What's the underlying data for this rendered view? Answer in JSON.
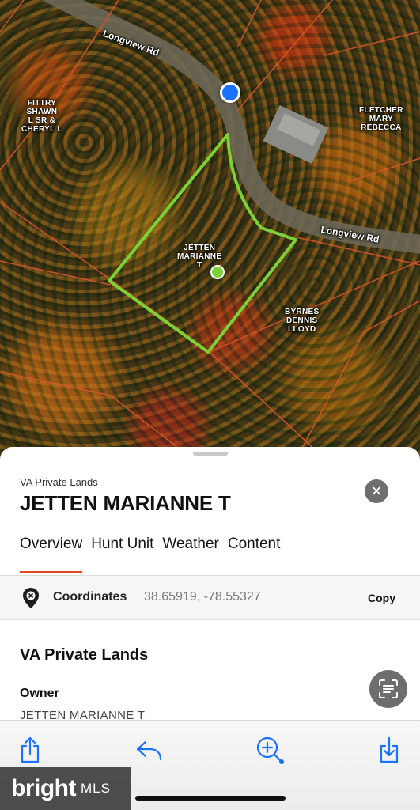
{
  "map": {
    "road_labels": [
      "Longview Rd",
      "Longview Rd"
    ],
    "owner_labels": {
      "fittry": "FITTRY\nSHAWN\nL SR &\nCHERYL L",
      "fletcher": "FLETCHER\nMARY\nREBECCA",
      "jetten": "JETTEN\nMARIANNE\nT",
      "byrnes": "BYRNES\nDENNIS\nLLOYD"
    },
    "colors": {
      "parcel_outline": "#7bd238",
      "location_dot": "#1a73ff",
      "boundary": "#d8552c"
    }
  },
  "sheet": {
    "subtitle": "VA Private Lands",
    "title": "JETTEN MARIANNE T",
    "close_icon": "close-icon",
    "tabs": [
      {
        "label": "Overview",
        "active": true
      },
      {
        "label": "Hunt Unit",
        "active": false
      },
      {
        "label": "Weather",
        "active": false
      },
      {
        "label": "Content",
        "active": false
      }
    ],
    "coordinates": {
      "label": "Coordinates",
      "value": "38.65919, -78.55327",
      "copy_label": "Copy"
    },
    "section_title": "VA Private Lands",
    "owner": {
      "label": "Owner",
      "value": "JETTEN MARIANNE T"
    },
    "accent_color": "#e2451f"
  },
  "toolbar": {
    "icons": [
      "share-icon",
      "reply-icon",
      "zoom-in-icon",
      "download-icon"
    ],
    "accent_color": "#1a73ff"
  },
  "watermark": {
    "brand": "bright",
    "suffix": "MLS"
  }
}
